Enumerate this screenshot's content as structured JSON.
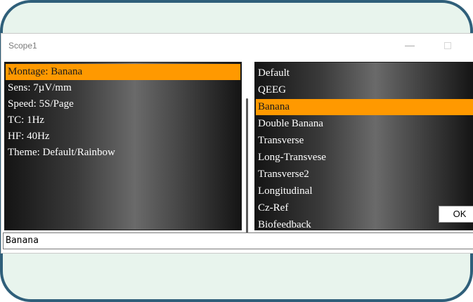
{
  "window": {
    "title": "Scope1"
  },
  "settings": {
    "items": [
      {
        "label": "Montage: Banana",
        "selected": true
      },
      {
        "label": "Sens: 7µV/mm",
        "selected": false
      },
      {
        "label": "Speed: 5S/Page",
        "selected": false
      },
      {
        "label": "TC: 1Hz",
        "selected": false
      },
      {
        "label": "HF: 40Hz",
        "selected": false
      },
      {
        "label": "Theme: Default/Rainbow",
        "selected": false
      }
    ]
  },
  "options": {
    "items": [
      {
        "label": "Default",
        "selected": false
      },
      {
        "label": "QEEG",
        "selected": false
      },
      {
        "label": "Banana",
        "selected": true
      },
      {
        "label": "Double Banana",
        "selected": false
      },
      {
        "label": "Transverse",
        "selected": false
      },
      {
        "label": "Long-Transvese",
        "selected": false
      },
      {
        "label": "Transverse2",
        "selected": false
      },
      {
        "label": "Longitudinal",
        "selected": false
      },
      {
        "label": "Cz-Ref",
        "selected": false
      },
      {
        "label": "Biofeedback",
        "selected": false
      }
    ]
  },
  "ok_label": "OK",
  "status": {
    "value": "Banana"
  },
  "colors": {
    "selection": "#ff9900",
    "frame_border": "#2f5f7a",
    "frame_background": "#e8f4ed"
  }
}
